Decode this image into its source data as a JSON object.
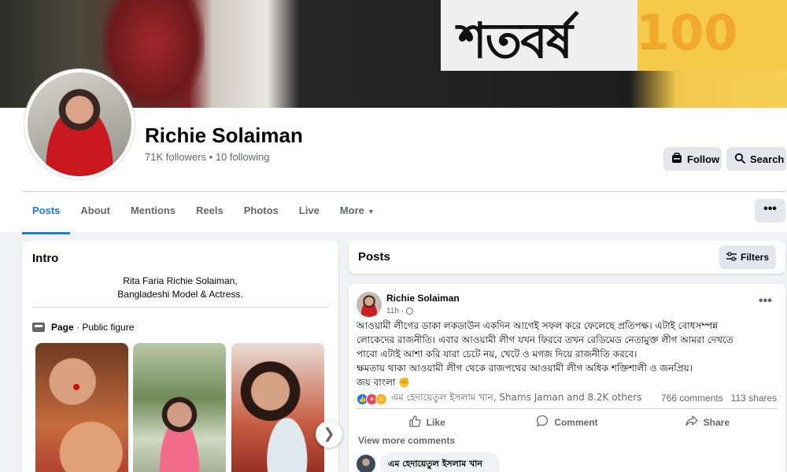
{
  "cover": {
    "text": "শতবর্ষ",
    "number": "100"
  },
  "profile": {
    "name": "Richie Solaiman",
    "stats": "71K followers • 10 following",
    "follow_label": "Follow",
    "search_label": "Search"
  },
  "tabs": [
    {
      "label": "Posts"
    },
    {
      "label": "About"
    },
    {
      "label": "Mentions"
    },
    {
      "label": "Reels"
    },
    {
      "label": "Photos"
    },
    {
      "label": "Live"
    },
    {
      "label": "More"
    }
  ],
  "more_menu": "•••",
  "intro": {
    "title": "Intro",
    "bio_line1": "Rita Faria Richie Solaiman,",
    "bio_line2": "Bangladeshi Model & Actress.",
    "page_label": "Page",
    "page_category": " · Public figure"
  },
  "posts_section": {
    "title": "Posts",
    "filters_label": "Filters"
  },
  "post": {
    "author": "Richie Solaiman",
    "time": "11h ·",
    "menu": "•••",
    "body": [
      "আওয়ামী লীগের ডাকা লকডাউন একদিন আগেই সফল করে ফেলেছে প্রতিপক্ষ। এটাই বোধসম্পন্ন",
      "লোকেদের রাজনীতি। এবার আওয়ামী লীগ যখন ফিরবে তখন রেডিমেড নেতামুক্ত লীগ আমরা দেখতে",
      "পাবো এটাই আশা করি যারা চেটে নয়, খেটে ও মগজ দিয়ে রাজনীতি করবে।",
      "ক্ষমতায় থাকা আওয়ামী লীগ থেকে রাজপথের আওয়ামী লীগ অধিক শক্তিশালী ও জনপ্রিয়।",
      "জয় বাংলা ✊"
    ],
    "reaction_names": "এম হেদায়েতুল ইসলাম খান, Shams Jaman and 8.2K others",
    "comments_count": "766 comments",
    "shares_count": "113 shares",
    "like_label": "Like",
    "comment_label": "Comment",
    "share_label": "Share",
    "view_more": "View more comments",
    "first_commenter": "এম হেদায়েতুল ইসলাম খান"
  }
}
